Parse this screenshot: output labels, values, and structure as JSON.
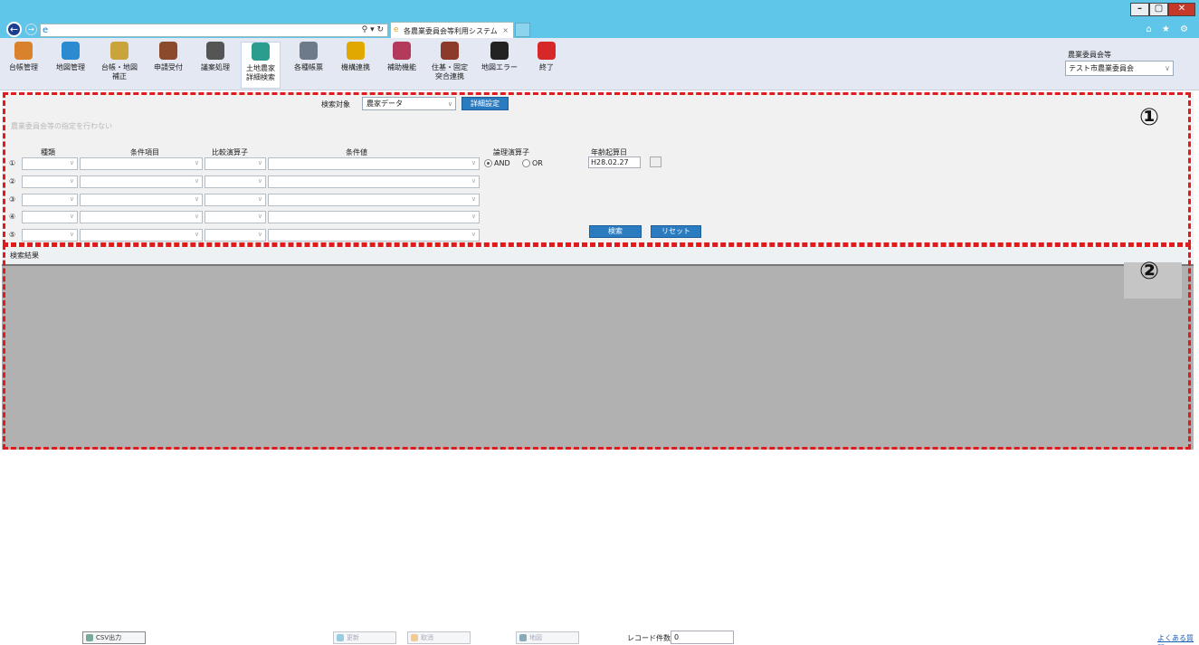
{
  "browser": {
    "tab_title": "各農業委員会等利用システム",
    "tab_close": "×",
    "addr_tools": "⚲ ▾ ↻",
    "window_buttons": [
      "–",
      "▢",
      "✕"
    ],
    "right_icons": "⌂ ★ ⚙"
  },
  "toolbar": {
    "items": [
      {
        "label": "台帳管理",
        "icon": "ledger-icon",
        "color": "#d9822b"
      },
      {
        "label": "地図管理",
        "icon": "globe-icon",
        "color": "#2c8ad0"
      },
      {
        "label": "台帳・地図\n補正",
        "icon": "ledger-map-icon",
        "color": "#c9a43a"
      },
      {
        "label": "申請受付",
        "icon": "stamp-icon",
        "color": "#8a4a2b"
      },
      {
        "label": "議案処理",
        "icon": "document-icon",
        "color": "#555555"
      },
      {
        "label": "土地農家\n詳細検索",
        "icon": "detail-search-icon",
        "color": "#2a9d8f"
      },
      {
        "label": "各種帳票",
        "icon": "printer-icon",
        "color": "#6c7a89"
      },
      {
        "label": "機構連携",
        "icon": "link-org-icon",
        "color": "#e0a800"
      },
      {
        "label": "補助機能",
        "icon": "tools-icon",
        "color": "#b33a5a"
      },
      {
        "label": "住基・固定\n突合連携",
        "icon": "records-icon",
        "color": "#8b3a2b"
      },
      {
        "label": "地図エラー",
        "icon": "chain-link-icon",
        "color": "#222222"
      },
      {
        "label": "終了",
        "icon": "exit-icon",
        "color": "#d62828"
      }
    ],
    "assoc_label": "農業委員会等",
    "assoc_value": "テスト市農業委員会"
  },
  "search": {
    "target_label": "検索対象",
    "target_value": "農家データ",
    "detail_button": "詳細設定",
    "no_filter_text": "農業委員会等の指定を行わない",
    "headers": {
      "kind": "種類",
      "item": "条件項目",
      "op": "比較演算子",
      "value": "条件値",
      "logic": "論理演算子",
      "age_date": "年齢起算日"
    },
    "row_nums": [
      "①",
      "②",
      "③",
      "④",
      "⑤"
    ],
    "logic_and": "AND",
    "logic_or": "OR",
    "age_date_value": "H28.02.27",
    "search_button": "検索",
    "reset_button": "リセット"
  },
  "results": {
    "header": "検索結果"
  },
  "annotations": {
    "marker1": "①",
    "marker2": "②",
    "color": "#e01b1b"
  },
  "footer": {
    "csv_button": "CSV出力",
    "update_button": "更新",
    "cancel_button": "取消",
    "map_button": "地図",
    "record_count_label": "レコード件数",
    "record_count": "0",
    "faq_link": "よくある質問"
  }
}
